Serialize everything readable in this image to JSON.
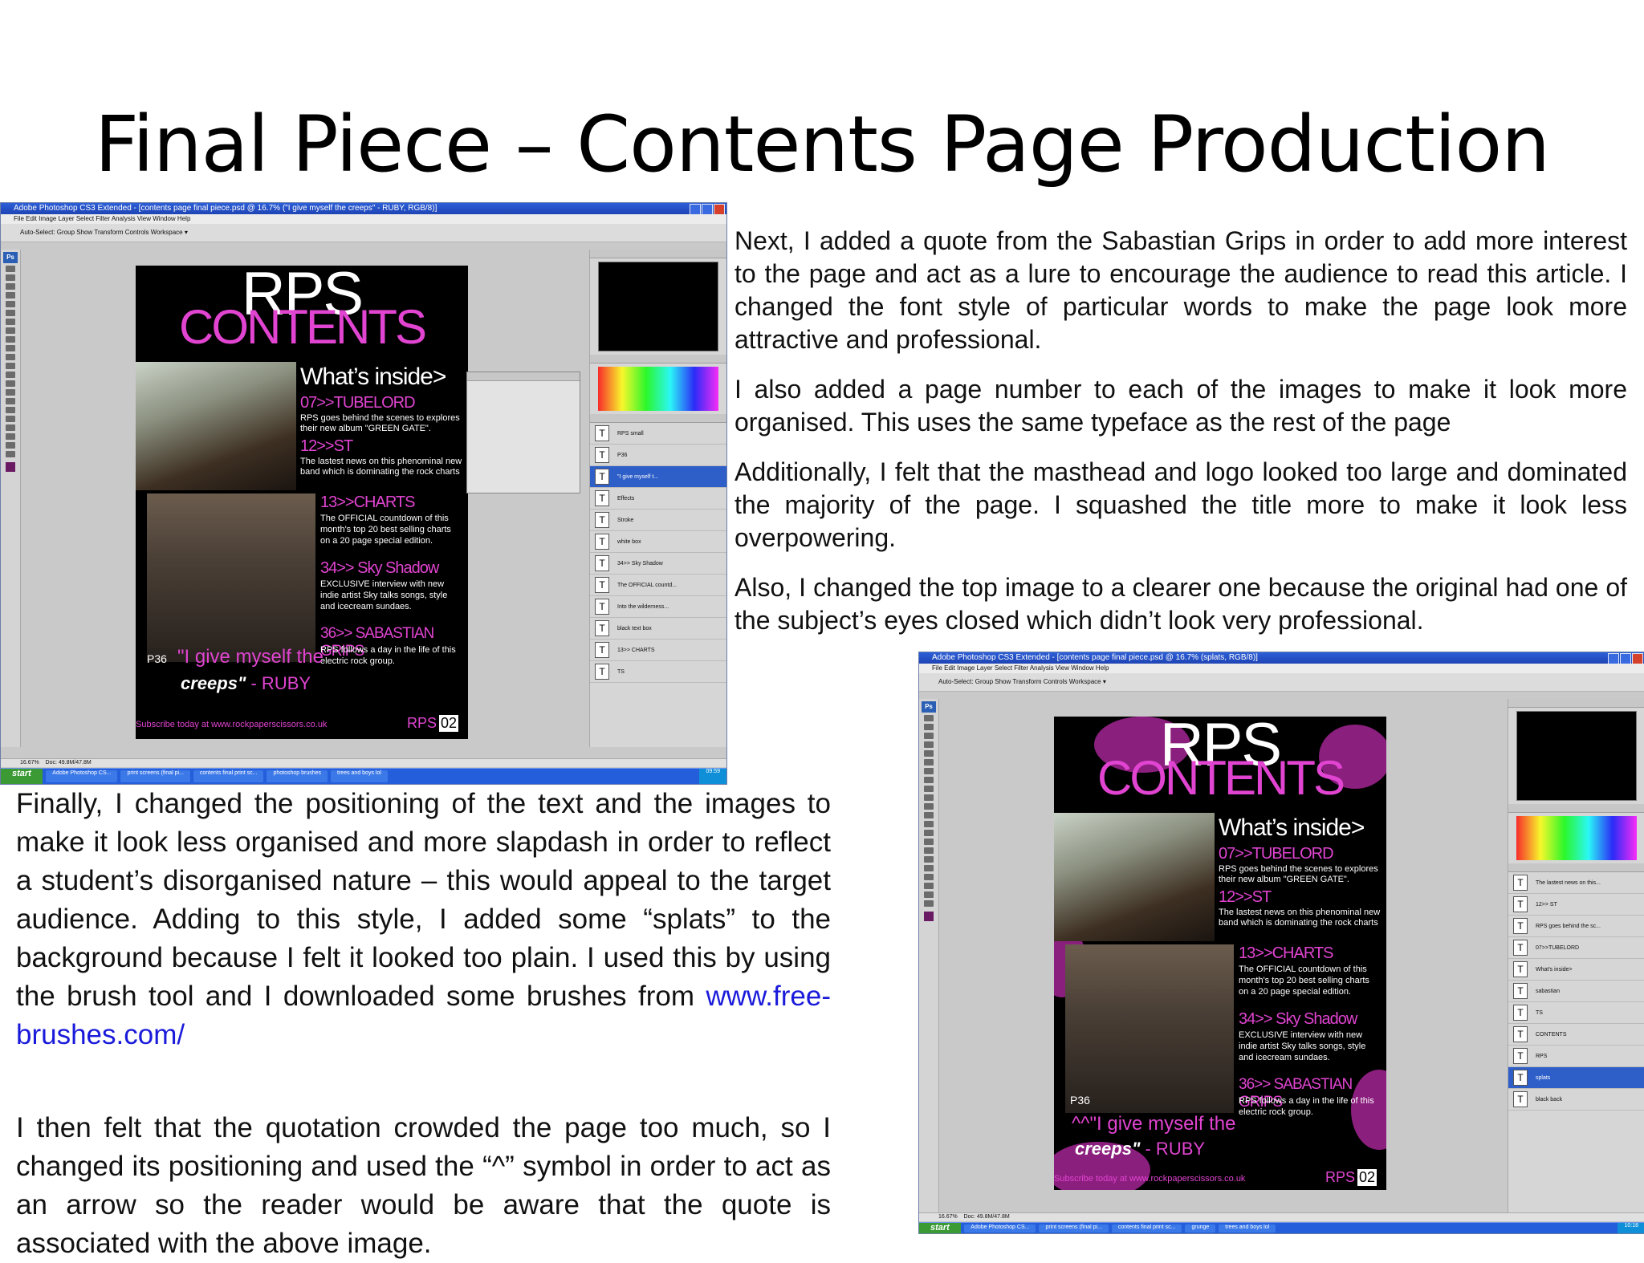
{
  "slide": {
    "title": "Final Piece – Contents Page Production"
  },
  "paragraphs": {
    "p1": "Next, I added a quote from the Sabastian Grips in order to add more interest to the page and act as a lure to encourage the audience to read this article. I changed the font style of particular words to make the page look more attractive and professional.",
    "p2": "I also added a page number to each of the images to make it look more organised. This uses the same typeface as the rest of the page",
    "p3": "Additionally, I felt that the masthead and logo looked too large and dominated the majority of the page. I squashed the title more to make it look less overpowering.",
    "p4": "Also, I changed the top image to a clearer one because the original had one of the subject’s eyes closed which didn’t look very professional.",
    "p5_text": "Finally, I changed the positioning of the text and the images to make it look less organised and more slapdash in order to reflect a student’s disorganised nature – this would appeal to the target audience. Adding to this style, I added some “splats” to the background because I felt it looked too plain. I used this by using the brush tool and I downloaded some brushes from",
    "p5_link": "www.free-brushes.com/",
    "p6": "I then felt that the quotation crowded the page too much, so I changed its positioning and used the “^” symbol in order to act as an arrow so the reader would be aware that the quote is associated with the above image."
  },
  "screenshot1": {
    "window_title": "Adobe Photoshop CS3 Extended - [contents page final piece.psd @ 16.7% (\"I give myself the creeps\" - RUBY, RGB/8)]",
    "menu": "File   Edit   Image   Layer   Select   Filter   Analysis   View   Window   Help",
    "options": "Auto-Select: Group    Show Transform Controls                        Workspace ▾",
    "zoom": "16.67%",
    "doc": "Doc: 49.8M/47.8M",
    "layers": [
      "RPS small",
      "P36",
      "\"I give myself t...",
      "Effects",
      "Stroke",
      "white box",
      "34>> Sky Shadow",
      "The OFFICIAL countd...",
      "Into the wilderness...",
      "black text box",
      "13>> CHARTS",
      "TS"
    ],
    "taskbar": [
      "Adobe Photoshop CS...",
      "print screens (final pi...",
      "contents final print sc...",
      "photoshop brushes",
      "trees and boys lol"
    ],
    "clock": "09:59"
  },
  "screenshot2": {
    "window_title": "Adobe Photoshop CS3 Extended - [contents page final piece.psd @ 16.7% (splats, RGB/8)]",
    "menu": "File   Edit   Image   Layer   Select   Filter   Analysis   View   Window   Help",
    "options": "Auto-Select: Group    Show Transform Controls                        Workspace ▾",
    "zoom": "16.67%",
    "doc": "Doc: 49.8M/47.8M",
    "layers": [
      "The lastest news on this...",
      "12>> ST",
      "RPS goes behind the sc...",
      "07>>TUBELORD",
      "What's inside>",
      "sabastian",
      "TS",
      "CONTENTS",
      "RPS",
      "splats",
      "black back"
    ],
    "taskbar": [
      "Adobe Photoshop CS...",
      "print screens (final pi...",
      "contents final print sc...",
      "grunge",
      "trees and boys lol"
    ],
    "clock": "10:18"
  },
  "magazine": {
    "masthead": "RPS",
    "contents": "CONTENTS",
    "whats_inside": "What’s inside>",
    "h1": "07>>TUBELORD",
    "t1": "RPS goes behind the scenes to explores their new album \"GREEN GATE\".",
    "h2": "12>>ST",
    "t2": "The lastest news on this phenominal new band which is dominating the rock charts",
    "h3": "13>>CHARTS",
    "t3": "The OFFICIAL countdown of this month's top 20 best selling charts on a 20 page special edition.",
    "h4": "34>> Sky Shadow",
    "t4": "EXCLUSIVE interview with new indie artist Sky talks songs, style and icecream sundaes.",
    "h5": "36>> SABASTIAN GRIPS",
    "t5": "RPS follows a day in the life of this electric rock group.",
    "page_tag": "P36",
    "quote1": "\"I give myself the",
    "quote2": "^^\"I give myself the",
    "creeps": "creeps\"",
    "creeps_by": " - RUBY",
    "subscribe": "Subscribe today at www.rockpaperscissors.co.uk",
    "footer_rps": "RPS",
    "footer_page": "02"
  },
  "colors": {
    "accent_pink": "#e044d0",
    "splat_purple": "#8b1f7e",
    "link_blue": "#1a1adb"
  }
}
